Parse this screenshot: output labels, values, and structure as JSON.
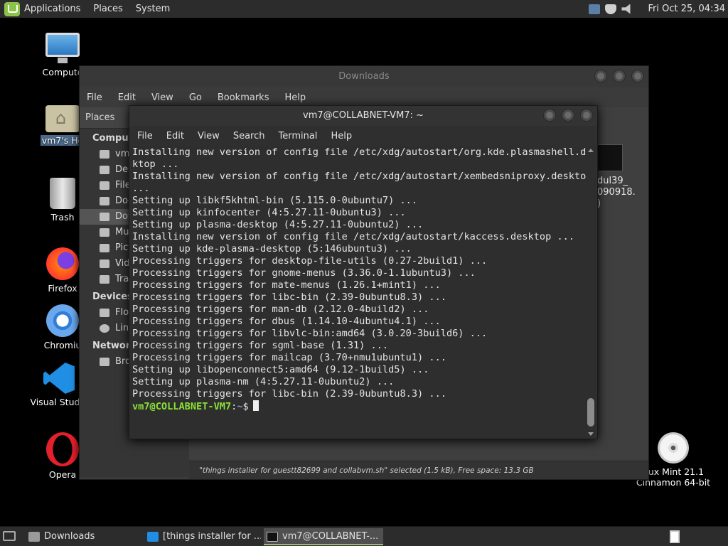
{
  "top_panel": {
    "menus": [
      "Applications",
      "Places",
      "System"
    ],
    "clock": "Fri Oct 25, 04:34",
    "tray_icons": [
      "network-icon",
      "shield-icon",
      "volume-icon"
    ]
  },
  "desktop_icons": [
    {
      "label": "Compute",
      "icon": "computer-icon"
    },
    {
      "label": "vm7's Ho",
      "icon": "home-folder-icon"
    },
    {
      "label": "Trash",
      "icon": "trash-icon"
    },
    {
      "label": "Firefox",
      "icon": "firefox-icon"
    },
    {
      "label": "Chromiu",
      "icon": "chromium-icon"
    },
    {
      "label": "Visual Studio",
      "icon": "vscode-icon"
    },
    {
      "label": "Opera",
      "icon": "opera-icon"
    },
    {
      "label": "nux Mint 21.1",
      "label2": "Cinnamon 64-bit",
      "icon": "cd-icon"
    }
  ],
  "file_manager": {
    "title": "Downloads",
    "menus": [
      "File",
      "Edit",
      "View",
      "Go",
      "Bookmarks",
      "Help"
    ],
    "places_label": "Places",
    "sections": [
      {
        "name": "Comput",
        "items": [
          "vm",
          "Des",
          "File",
          "Doc",
          "Dov",
          "Mu",
          "Pict",
          "Vid",
          "Tra"
        ]
      },
      {
        "name": "Devices",
        "items": [
          "Flo",
          "Lin"
        ]
      },
      {
        "name": "Network",
        "items": [
          "Bro"
        ]
      }
    ],
    "file_label_lines": [
      "dul39_",
      "090918.",
      ")"
    ],
    "status": "\"things installer for guestt82699 and collabvm.sh\" selected (1.5 kB), Free space: 13.3 GB"
  },
  "terminal": {
    "title": "vm7@COLLABNET-VM7: ~",
    "menus": [
      "File",
      "Edit",
      "View",
      "Search",
      "Terminal",
      "Help"
    ],
    "lines": [
      "Installing new version of config file /etc/xdg/autostart/org.kde.plasmashell.des",
      "ktop ...",
      "Installing new version of config file /etc/xdg/autostart/xembedsniproxy.desktop",
      "...",
      "Setting up libkf5khtml-bin (5.115.0-0ubuntu7) ...",
      "Setting up kinfocenter (4:5.27.11-0ubuntu3) ...",
      "Setting up plasma-desktop (4:5.27.11-0ubuntu2) ...",
      "Installing new version of config file /etc/xdg/autostart/kaccess.desktop ...",
      "Setting up kde-plasma-desktop (5:146ubuntu3) ...",
      "Processing triggers for desktop-file-utils (0.27-2build1) ...",
      "Processing triggers for gnome-menus (3.36.0-1.1ubuntu3) ...",
      "Processing triggers for mate-menus (1.26.1+mint1) ...",
      "Processing triggers for libc-bin (2.39-0ubuntu8.3) ...",
      "Processing triggers for man-db (2.12.0-4build2) ...",
      "Processing triggers for dbus (1.14.10-4ubuntu4.1) ...",
      "Processing triggers for libvlc-bin:amd64 (3.0.20-3build6) ...",
      "Processing triggers for sgml-base (1.31) ...",
      "Processing triggers for mailcap (3.70+nmu1ubuntu1) ...",
      "Setting up libopenconnect5:amd64 (9.12-1build5) ...",
      "Setting up plasma-nm (4:5.27.11-0ubuntu2) ...",
      "Processing triggers for libc-bin (2.39-0ubuntu8.3) ..."
    ],
    "prompt_user": "vm7@COLLABNET-VM7",
    "prompt_sep": ":",
    "prompt_path": "~",
    "prompt_symbol": "$"
  },
  "taskbar": {
    "tasks": [
      {
        "label": "Downloads",
        "icon": "folder-icon",
        "active": false
      },
      {
        "label": "[things installer for ...",
        "icon": "vscode-icon",
        "active": false
      },
      {
        "label": "vm7@COLLABNET-...",
        "icon": "terminal-icon",
        "active": true
      }
    ]
  }
}
